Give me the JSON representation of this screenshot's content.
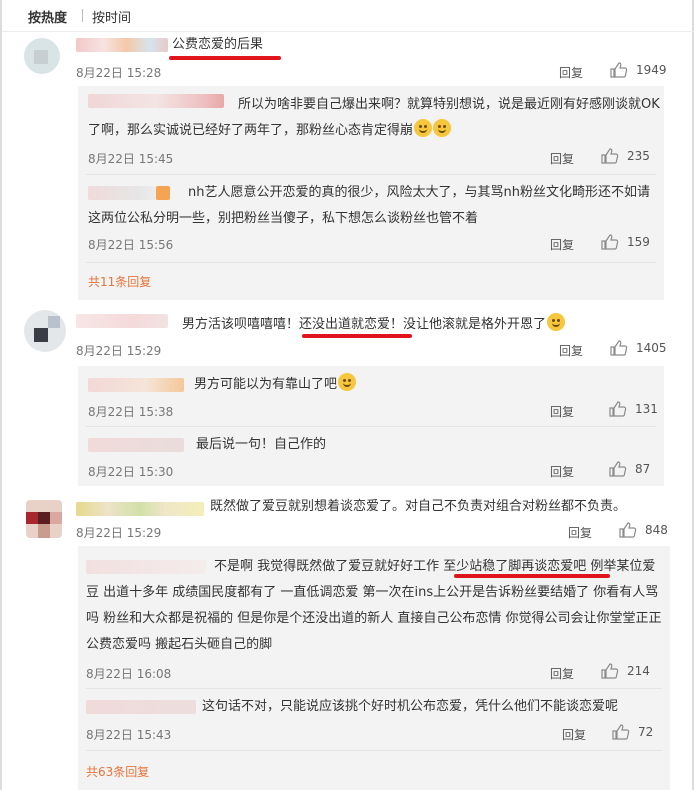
{
  "tabs": {
    "hot": "按热度",
    "time": "按时间"
  },
  "comments": [
    {
      "text": "公费恋爱的后果",
      "time": "8月22日 15:28",
      "reply": "回复",
      "likes": "1949",
      "subreplies": [
        {
          "text": "所以为啥非要自己爆出来啊？就算特别想说，说是最近刚有好感刚谈就OK了啊，那么实诚说已经好了两年了，那粉丝心态肯定得崩",
          "time": "8月22日 15:45",
          "reply": "回复",
          "likes": "235"
        },
        {
          "text": "nh艺人愿意公开恋爱的真的很少，风险太大了，与其骂nh粉丝文化畸形还不如请这两位公私分明一些，别把粉丝当傻子，私下想怎么谈粉丝也管不着",
          "time": "8月22日 15:56",
          "reply": "回复",
          "likes": "159"
        }
      ],
      "more": "共11条回复"
    },
    {
      "text_a": "男方活该呗嘻嘻嘻！",
      "text_b": "还没出道就恋爱！",
      "text_c": "没让他滚就是格外开恩了",
      "time": "8月22日 15:29",
      "reply": "回复",
      "likes": "1405",
      "subreplies": [
        {
          "text": "男方可能以为有靠山了吧",
          "time": "8月22日 15:38",
          "reply": "回复",
          "likes": "131"
        },
        {
          "text": "最后说一句！自己作的",
          "time": "8月22日 15:30",
          "reply": "回复",
          "likes": "87"
        }
      ]
    },
    {
      "text": "既然做了爱豆就别想着谈恋爱了。对自己不负责对组合对粉丝都不负责。",
      "time": "8月22日 15:29",
      "reply": "回复",
      "likes": "848",
      "subreplies": [
        {
          "text_a": "不是啊 我觉得既然做了爱豆就好好工作 ",
          "text_b": "至少站稳了脚再谈恋爱吧",
          "text_c": " 例举某位爱豆 出道十多年 成绩国民度都有了 一直低调恋爱 第一次在ins上公开是告诉粉丝要结婚了 你看有人骂吗 粉丝和大众都是祝福的 但是你是个还没出道的新人 直接自己公布恋情 你觉得公司会让你堂堂正正公费恋爱吗 搬起石头砸自己的脚",
          "time": "8月22日 16:08",
          "reply": "回复",
          "likes": "214"
        },
        {
          "text": "这句话不对，只能说应该挑个好时机公布恋爱，凭什么他们不能谈恋爱呢",
          "time": "8月22日 15:43",
          "reply": "回复",
          "likes": "72"
        }
      ],
      "more": "共63条回复"
    }
  ],
  "colors": {
    "accent": "#e8733a",
    "underline": "#e0141c",
    "subbg": "#f3f3f3"
  }
}
